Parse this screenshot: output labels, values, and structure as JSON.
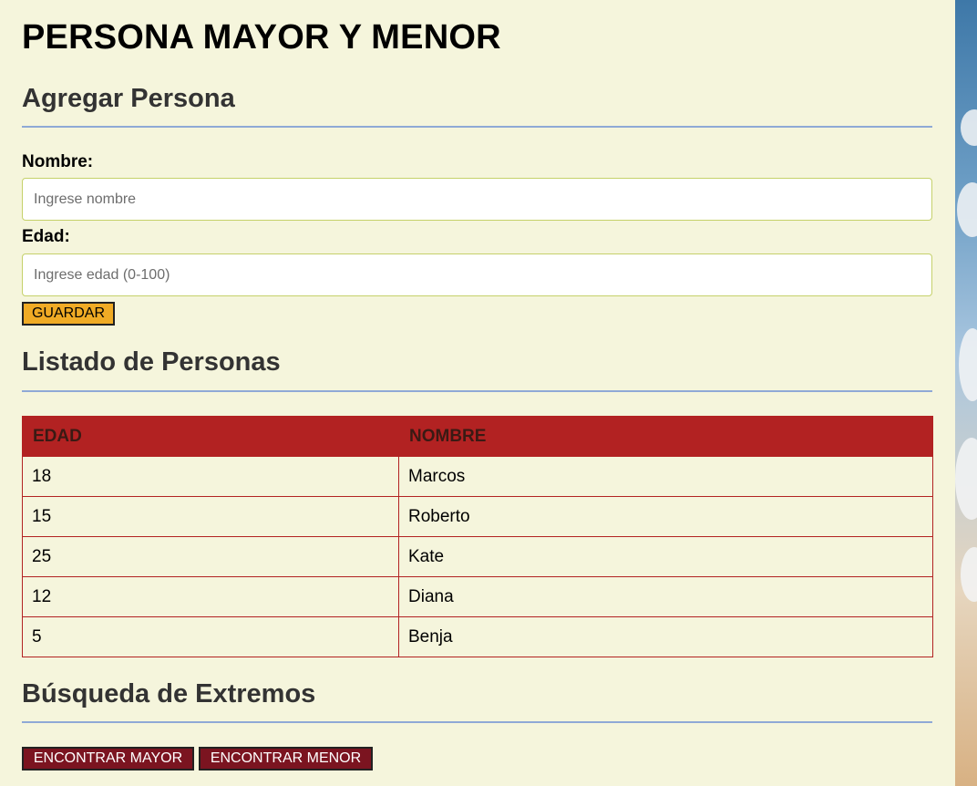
{
  "page": {
    "title": "PERSONA MAYOR Y MENOR"
  },
  "form": {
    "section_title": "Agregar Persona",
    "name_label": "Nombre:",
    "name_placeholder": "Ingrese nombre",
    "name_value": "",
    "age_label": "Edad:",
    "age_placeholder": "Ingrese edad (0-100)",
    "age_value": "",
    "save_label": "GUARDAR"
  },
  "listing": {
    "section_title": "Listado de Personas",
    "columns": [
      "EDAD",
      "NOMBRE"
    ],
    "rows": [
      {
        "edad": "18",
        "nombre": "Marcos"
      },
      {
        "edad": "15",
        "nombre": "Roberto"
      },
      {
        "edad": "25",
        "nombre": "Kate"
      },
      {
        "edad": "12",
        "nombre": "Diana"
      },
      {
        "edad": "5",
        "nombre": "Benja"
      }
    ]
  },
  "extremes": {
    "section_title": "Búsqueda de Extremos",
    "find_max_label": "ENCONTRAR MAYOR",
    "find_min_label": "ENCONTRAR MENOR"
  },
  "colors": {
    "page_background": "#f5f5dc",
    "table_header": "#b22222",
    "save_button": "#f0ab25",
    "action_buttons": "#7b1420",
    "section_rule": "#8fa9d6"
  }
}
